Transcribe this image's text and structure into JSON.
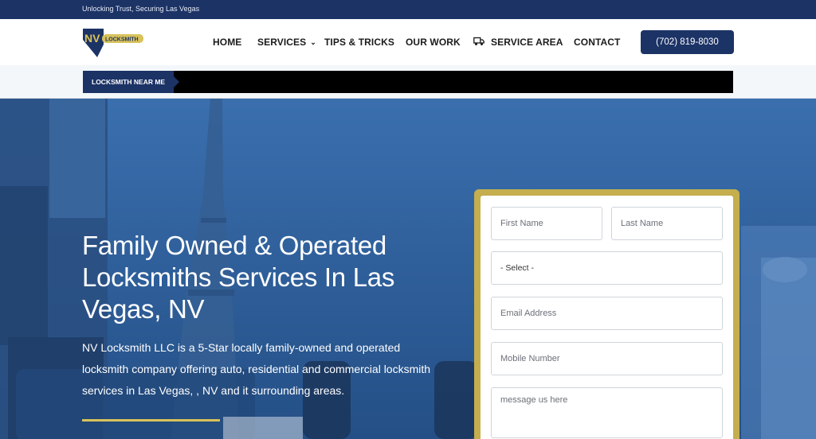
{
  "topbar": {
    "tagline": "Unlocking Trust, Securing Las Vegas"
  },
  "brand": {
    "logo_text": "NV LOCKSMITH",
    "primary_color": "#1c3366",
    "accent_color": "#d8c25a"
  },
  "nav": {
    "items": [
      {
        "label": "HOME"
      },
      {
        "label": "SERVICES",
        "has_dropdown": true
      },
      {
        "label": "TIPS & TRICKS"
      },
      {
        "label": "OUR WORK"
      },
      {
        "label": "SERVICE AREA",
        "icon": "truck-icon"
      },
      {
        "label": "CONTACT"
      }
    ],
    "phone": "(702) 819-8030"
  },
  "ticker": {
    "tag": "LOCKSMITH NEAR ME"
  },
  "hero": {
    "title": "Family Owned & Operated Locksmiths Services In Las Vegas, NV",
    "description": "NV Locksmith LLC is a 5-Star locally family-owned and operated locksmith company offering auto, residential and commercial locksmith services in Las Vegas, , NV and it surrounding areas."
  },
  "form": {
    "first_name_placeholder": "First Name",
    "last_name_placeholder": "Last Name",
    "select_value": "- Select -",
    "email_placeholder": "Email Address",
    "mobile_placeholder": "Mobile Number",
    "message_placeholder": "message us here"
  }
}
